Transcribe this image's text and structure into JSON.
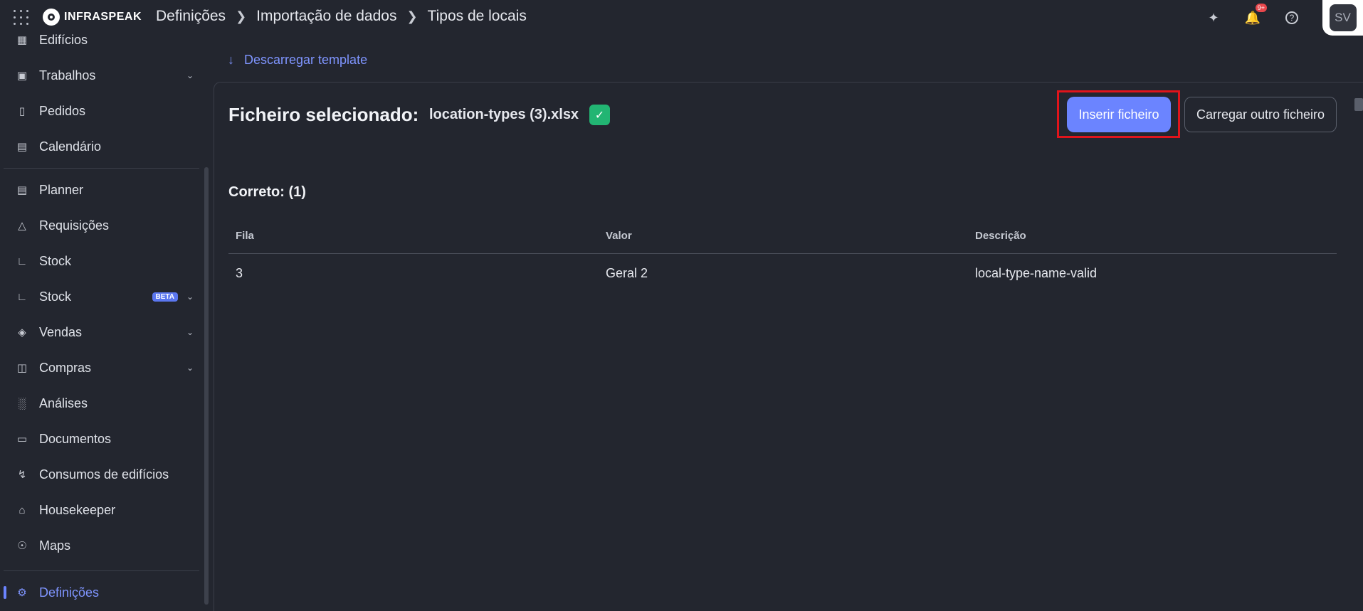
{
  "header": {
    "logo_text": "INFRASPEAK",
    "breadcrumb": [
      "Definições",
      "Importação de dados",
      "Tipos de locais"
    ],
    "notification_badge": "9+",
    "help_symbol": "?",
    "avatar_initials": "SV"
  },
  "sidebar": {
    "items": [
      {
        "label": "Edifícios",
        "icon": "building-icon"
      },
      {
        "label": "Trabalhos",
        "icon": "toolbox-icon"
      },
      {
        "label": "Pedidos",
        "icon": "clipboard-icon"
      },
      {
        "label": "Calendário",
        "icon": "calendar-icon"
      },
      {
        "label": "Planner",
        "icon": "planner-icon"
      },
      {
        "label": "Requisições",
        "icon": "bell-service-icon"
      },
      {
        "label": "Stock",
        "icon": "cart-dolly-icon"
      },
      {
        "label": "Stock",
        "icon": "cart-dolly-icon",
        "badge": "BETA"
      },
      {
        "label": "Vendas",
        "icon": "tag-icon"
      },
      {
        "label": "Compras",
        "icon": "shopping-cart-icon"
      },
      {
        "label": "Análises",
        "icon": "bar-chart-icon"
      },
      {
        "label": "Documentos",
        "icon": "document-icon"
      },
      {
        "label": "Consumos de edifícios",
        "icon": "lightning-icon"
      },
      {
        "label": "Housekeeper",
        "icon": "housekeeper-icon"
      },
      {
        "label": "Maps",
        "icon": "map-pin-icon"
      },
      {
        "label": "Definições",
        "icon": "gear-icon"
      }
    ]
  },
  "main": {
    "download_label": "Descarregar template",
    "file_label": "Ficheiro selecionado:",
    "file_name": "location-types (3).xlsx",
    "insert_button": "Inserir ficheiro",
    "upload_other_button": "Carregar outro ficheiro",
    "correct_label": "Correto: (1)",
    "table": {
      "headers": [
        "Fila",
        "Valor",
        "Descrição"
      ],
      "rows": [
        [
          "3",
          "Geral 2",
          "local-type-name-valid"
        ]
      ]
    }
  },
  "colors": {
    "background": "#23262f",
    "accent": "#6b84ff",
    "success": "#22b573",
    "alert": "#e8474c",
    "highlight_frame": "#e0141b"
  }
}
